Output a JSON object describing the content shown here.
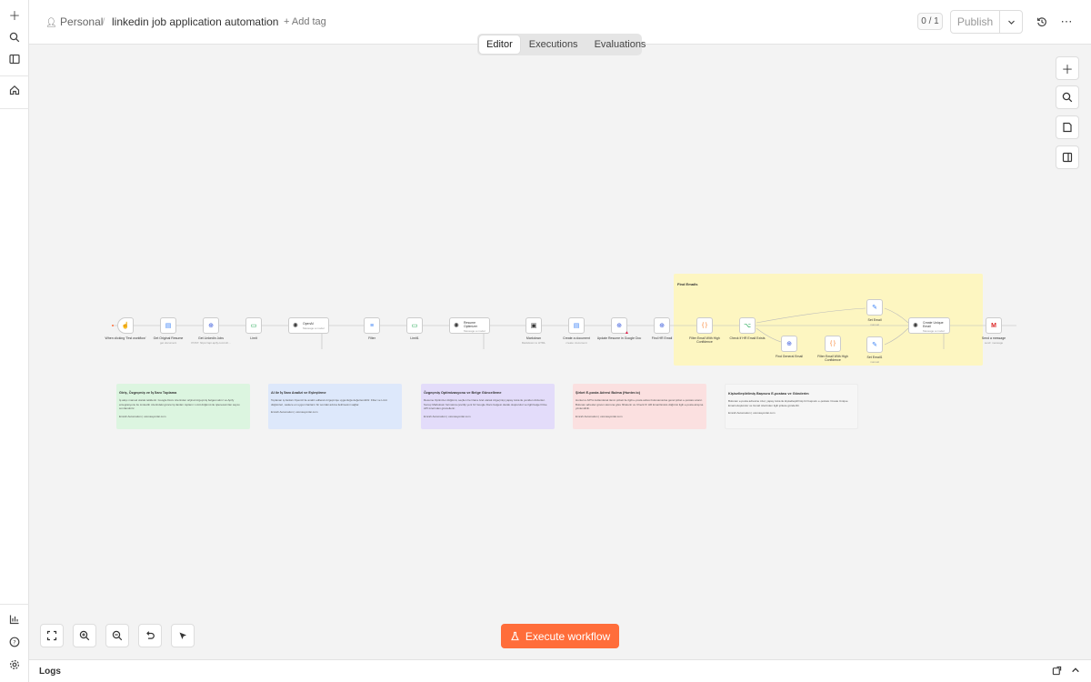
{
  "rail": {
    "icons": [
      "plus-icon",
      "search-icon",
      "sidebar-toggle-icon",
      "home-icon",
      "insights-icon",
      "help-icon",
      "settings-icon"
    ]
  },
  "header": {
    "project": "Personal",
    "separator": "/",
    "workflow_name": "linkedin job application automation",
    "add_tag": "+ Add tag",
    "version_counter": "0 / 1",
    "publish_label": "Publish"
  },
  "tabs": [
    {
      "label": "Editor",
      "active": true
    },
    {
      "label": "Executions",
      "active": false
    },
    {
      "label": "Evaluations",
      "active": false
    }
  ],
  "canvas": {
    "group_title": "Find Emails",
    "nodes": [
      {
        "name": "When clicking 'Test workflow'",
        "sub": "",
        "glyph": "☝"
      },
      {
        "name": "Get Original Resume",
        "sub": "get document",
        "glyph": "▤"
      },
      {
        "name": "Get Linkedin Jobs",
        "sub": "POST: https://api.apify.com/v2/...",
        "glyph": "⊕"
      },
      {
        "name": "Limit",
        "sub": "",
        "glyph": "▭"
      },
      {
        "name": "OpenAI",
        "sub": "Message a model",
        "glyph": "✺"
      },
      {
        "name": "Filter",
        "sub": "",
        "glyph": "≡"
      },
      {
        "name": "Limit1",
        "sub": "",
        "glyph": "▭"
      },
      {
        "name": "Resume Optimizer",
        "sub": "Message a model",
        "glyph": "✺"
      },
      {
        "name": "Markdown",
        "sub": "Markdown to HTML",
        "glyph": "▣"
      },
      {
        "name": "Create a document",
        "sub": "create: document",
        "glyph": "▤"
      },
      {
        "name": "Update Resume in Google Doc",
        "sub": "",
        "glyph": "⊕"
      },
      {
        "name": "Find HR Email",
        "sub": "",
        "glyph": "⊕"
      },
      {
        "name": "Filter Email With High Confidence",
        "sub": "",
        "glyph": "{ }"
      },
      {
        "name": "Check If HR Email Exists",
        "sub": "",
        "glyph": "⌥"
      },
      {
        "name": "Find General Email",
        "sub": "",
        "glyph": "⊕"
      },
      {
        "name": "Filter Email With High Confidence",
        "sub": "",
        "glyph": "{ }"
      },
      {
        "name": "Set Email",
        "sub": "manual",
        "glyph": "✎"
      },
      {
        "name": "Set Email1",
        "sub": "manual",
        "glyph": "✎"
      },
      {
        "name": "Create Unique Email",
        "sub": "Message a model",
        "glyph": "✺"
      },
      {
        "name": "Send a message",
        "sub": "send: message",
        "glyph": "M"
      }
    ],
    "notes": [
      {
        "title": "Giriş, Özgeçmiş ve İş İlanı Toplama",
        "body": "İş akışı manuel olarak tetiklenir. Google Docs üzerinden orijinal özgeçmiş belgesi alınır ve Apify entegrasyonu ile LinkedIn üzerindeki güncel iş ilanları toplanır. Limit düğümü ile işlenecek ilan sayısı sınırlandırılır.",
        "footer": "Emrah Automation | otomasyonlar.com",
        "color": "#dcf5e0"
      },
      {
        "title": "AI ile İş İlanı Analizi ve Eşleştirme",
        "body": "Toplanan iş ilanları OpenAI ile analiz edilerek özgeçmişe uygunluğa değerlendirilir. Filter ve Limit düğümleri, sadece en uygun ilanların bir sonraki adıma iletilmesini sağlar.",
        "footer": "Emrah Automation | otomasyonlar.com",
        "color": "#dde8fb"
      },
      {
        "title": "Özgeçmiş Optimizasyonu ve Belge Güncelleme",
        "body": "Resume Optimizer düğümü, seçilen her ilana özel olarak özgeçmişi yapay zeka ile yeniden düzenler. Sonuç Markdown formatına çevrilip yeni bir Google Docs belgesi olarak oluşturulur ve ilgili belge Drive API üzerinden güncellenir.",
        "footer": "Emrah Automation | otomasyonlar.com",
        "color": "#e3dcfa"
      },
      {
        "title": "Şirket E-posta Adresi Bulma (Hunter.io)",
        "body": "Hunter.io API'si kullanılarak ilanın şirketi ile ilgili e-posta adresi bulunamazsa genel şirket e-postası aranır. Bulunan adresler güven skoruna göre filtrelenir ve Check IF HR Email Exists düğümü ilgili e-posta akışına yönlendirilir.",
        "footer": "Emrah Automation | otomasyonlar.com",
        "color": "#fbe0e0"
      },
      {
        "title": "Kişiselleştirilmiş Başvuru E-postası ve Gönderim",
        "body": "Bulunan e-posta adresine özel, yapay zeka ile kişiselleştirilmiş bir başvuru e-postası Create Unique Email oluşturulur ve Gmail üzerinden ilgili şirkete gönderilir.",
        "footer": "Emrah Automation | otomasyonlar.com",
        "color": "#f6f6f6"
      }
    ]
  },
  "bottom": {
    "execute_label": "Execute workflow"
  },
  "logs": {
    "label": "Logs"
  }
}
